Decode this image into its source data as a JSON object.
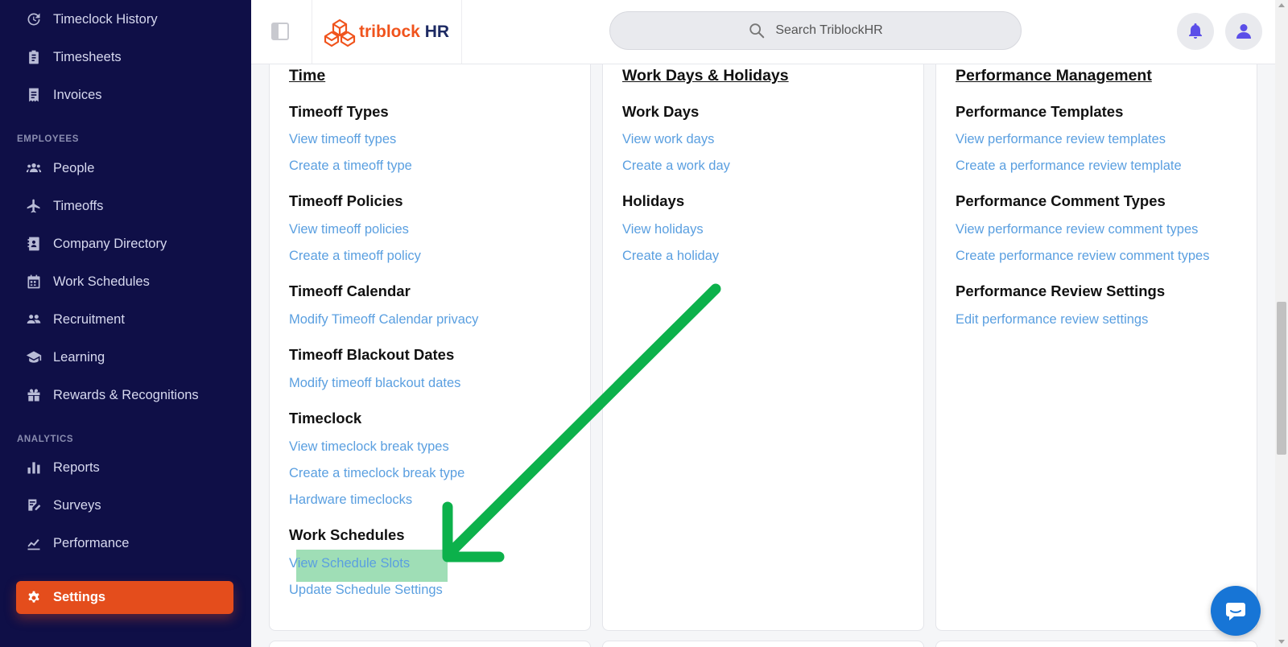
{
  "sidebar": {
    "top_items": [
      {
        "label": "Timeclock History",
        "icon": "clock-history-icon"
      },
      {
        "label": "Timesheets",
        "icon": "clipboard-icon"
      },
      {
        "label": "Invoices",
        "icon": "invoice-icon"
      }
    ],
    "employees_label": "EMPLOYEES",
    "employee_items": [
      {
        "label": "People",
        "icon": "users-icon"
      },
      {
        "label": "Timeoffs",
        "icon": "plane-icon"
      },
      {
        "label": "Company Directory",
        "icon": "address-book-icon"
      },
      {
        "label": "Work Schedules",
        "icon": "calendar-icon"
      },
      {
        "label": "Recruitment",
        "icon": "recruit-icon"
      },
      {
        "label": "Learning",
        "icon": "graduation-cap-icon"
      },
      {
        "label": "Rewards & Recognitions",
        "icon": "gift-icon"
      }
    ],
    "analytics_label": "ANALYTICS",
    "analytics_items": [
      {
        "label": "Reports",
        "icon": "bar-chart-icon"
      },
      {
        "label": "Surveys",
        "icon": "survey-icon"
      },
      {
        "label": "Performance",
        "icon": "line-chart-icon"
      }
    ],
    "settings": {
      "label": "Settings",
      "icon": "gear-icon"
    }
  },
  "topbar": {
    "logo_part1": "triblock",
    "logo_part2": "HR",
    "search_placeholder": "Search TriblockHR"
  },
  "columns": [
    {
      "title": "Time",
      "groups": [
        {
          "title": "Timeoff Types",
          "links": [
            "View timeoff types",
            "Create a timeoff type"
          ]
        },
        {
          "title": "Timeoff Policies",
          "links": [
            "View timeoff policies",
            "Create a timeoff policy"
          ]
        },
        {
          "title": "Timeoff Calendar",
          "links": [
            "Modify Timeoff Calendar privacy"
          ]
        },
        {
          "title": "Timeoff Blackout Dates",
          "links": [
            "Modify timeoff blackout dates"
          ]
        },
        {
          "title": "Timeclock",
          "links": [
            "View timeclock break types",
            "Create a timeclock break type",
            "Hardware timeclocks"
          ]
        },
        {
          "title": "Work Schedules",
          "links": [
            "View Schedule Slots",
            "Update Schedule Settings"
          ]
        }
      ]
    },
    {
      "title": "Work Days & Holidays",
      "groups": [
        {
          "title": "Work Days",
          "links": [
            "View work days",
            "Create a work day"
          ]
        },
        {
          "title": "Holidays",
          "links": [
            "View holidays",
            "Create a holiday"
          ]
        }
      ]
    },
    {
      "title": "Performance Management",
      "groups": [
        {
          "title": "Performance Templates",
          "links": [
            "View performance review templates",
            "Create a performance review template"
          ]
        },
        {
          "title": "Performance Comment Types",
          "links": [
            "View performance review comment types",
            "Create performance review comment types"
          ]
        },
        {
          "title": "Performance Review Settings",
          "links": [
            "Edit performance review settings"
          ]
        }
      ]
    }
  ],
  "colors": {
    "sidebar_bg": "#0f0f47",
    "accent": "#e44d1c",
    "link": "#5a9fe0",
    "highlight": "#7fd39e",
    "arrow": "#0cb14b",
    "chat": "#1775d6"
  }
}
